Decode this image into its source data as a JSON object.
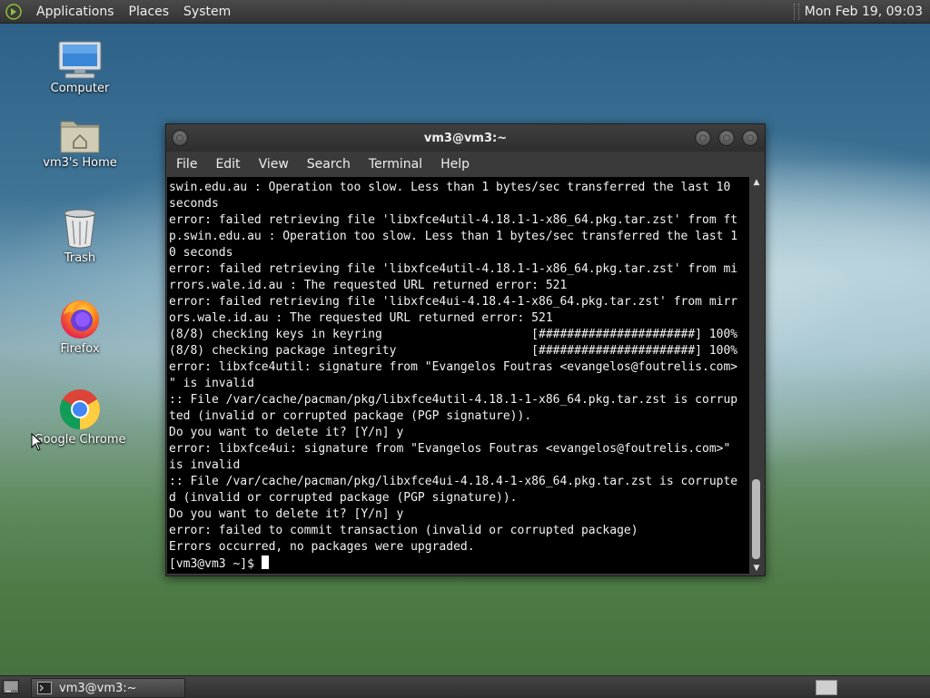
{
  "top_panel": {
    "menus": [
      "Applications",
      "Places",
      "System"
    ],
    "clock": "Mon Feb 19, 09:03"
  },
  "desktop": {
    "icons": [
      {
        "label": "Computer",
        "icon": "computer-icon"
      },
      {
        "label": "vm3's Home",
        "icon": "home-folder-icon"
      },
      {
        "label": "Trash",
        "icon": "trash-icon"
      },
      {
        "label": "Firefox",
        "icon": "firefox-icon"
      },
      {
        "label": "Google Chrome",
        "icon": "chrome-icon"
      }
    ]
  },
  "terminal": {
    "title": "vm3@vm3:~",
    "menus": [
      "File",
      "Edit",
      "View",
      "Search",
      "Terminal",
      "Help"
    ],
    "lines": [
      "swin.edu.au : Operation too slow. Less than 1 bytes/sec transferred the last 10",
      "seconds",
      "error: failed retrieving file 'libxfce4util-4.18.1-1-x86_64.pkg.tar.zst' from ft",
      "p.swin.edu.au : Operation too slow. Less than 1 bytes/sec transferred the last 1",
      "0 seconds",
      "error: failed retrieving file 'libxfce4util-4.18.1-1-x86_64.pkg.tar.zst' from mi",
      "rrors.wale.id.au : The requested URL returned error: 521",
      "error: failed retrieving file 'libxfce4ui-4.18.4-1-x86_64.pkg.tar.zst' from mirr",
      "ors.wale.id.au : The requested URL returned error: 521",
      "(8/8) checking keys in keyring                     [######################] 100%",
      "(8/8) checking package integrity                   [######################] 100%",
      "error: libxfce4util: signature from \"Evangelos Foutras <evangelos@foutrelis.com>",
      "\" is invalid",
      ":: File /var/cache/pacman/pkg/libxfce4util-4.18.1-1-x86_64.pkg.tar.zst is corrup",
      "ted (invalid or corrupted package (PGP signature)).",
      "Do you want to delete it? [Y/n] y",
      "error: libxfce4ui: signature from \"Evangelos Foutras <evangelos@foutrelis.com>\"",
      "is invalid",
      ":: File /var/cache/pacman/pkg/libxfce4ui-4.18.4-1-x86_64.pkg.tar.zst is corrupte",
      "d (invalid or corrupted package (PGP signature)).",
      "Do you want to delete it? [Y/n] y",
      "error: failed to commit transaction (invalid or corrupted package)",
      "Errors occurred, no packages were upgraded."
    ],
    "prompt": "[vm3@vm3 ~]$ "
  },
  "bottom_panel": {
    "task_label": "vm3@vm3:~"
  }
}
